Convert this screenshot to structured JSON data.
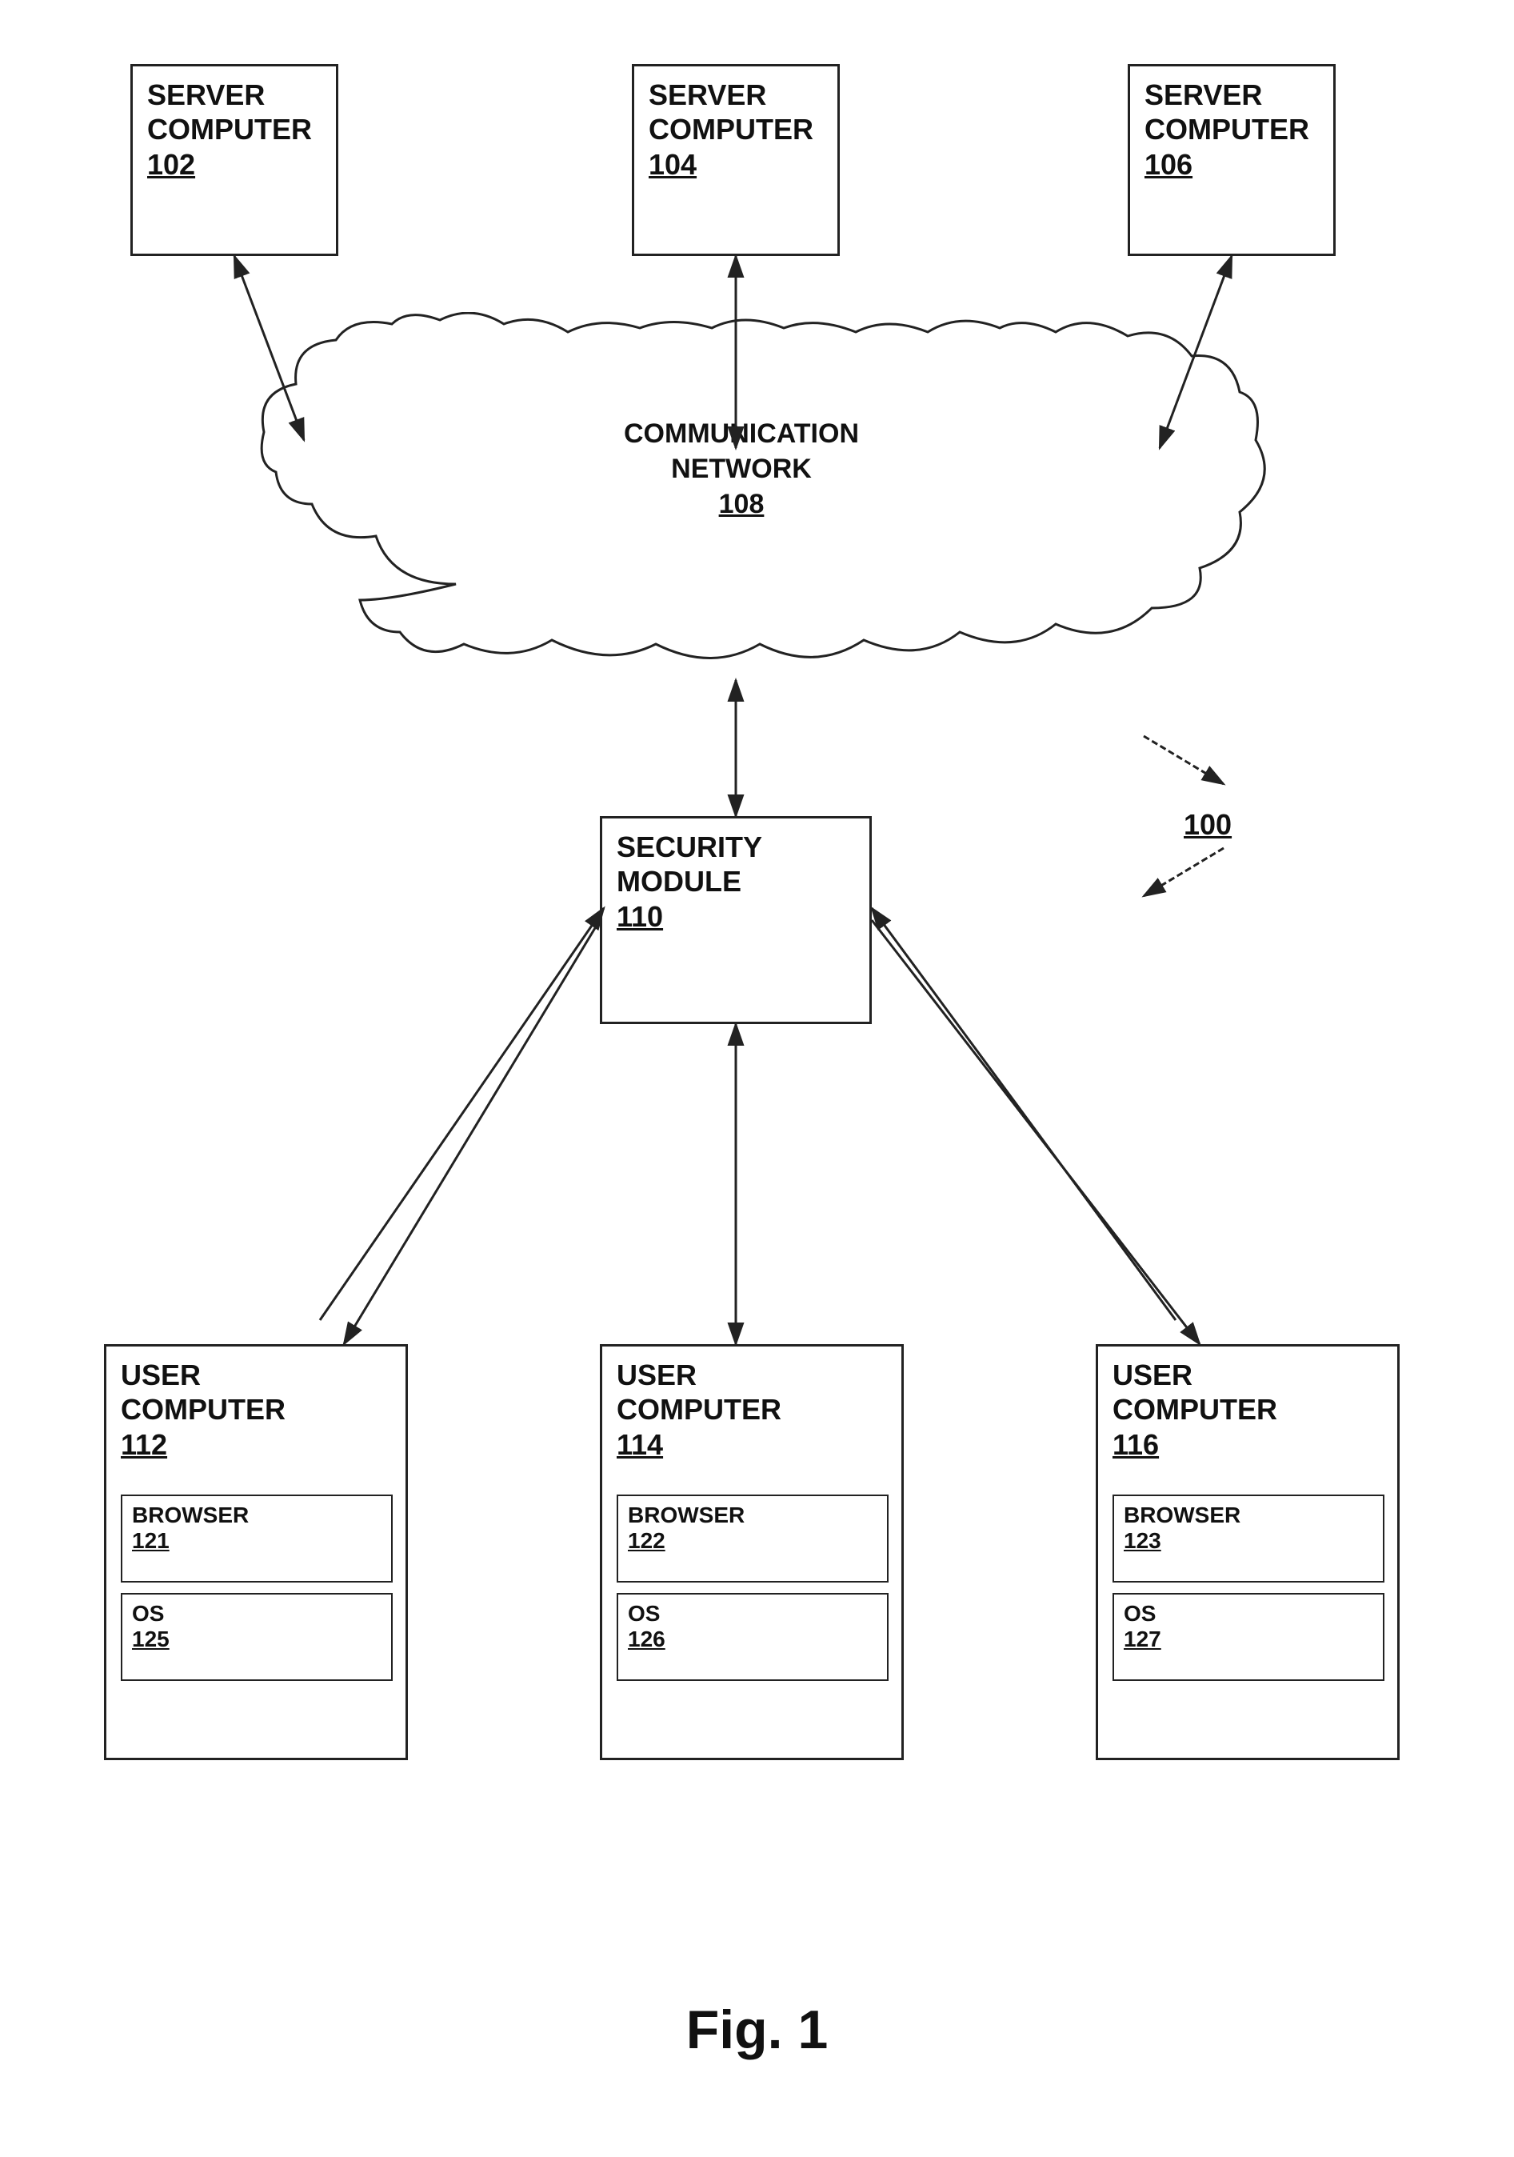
{
  "title": "Fig. 1",
  "servers": [
    {
      "id": "server-102",
      "line1": "SERVER",
      "line2": "COMPUTER",
      "number": "102"
    },
    {
      "id": "server-104",
      "line1": "SERVER",
      "line2": "COMPUTER",
      "number": "104"
    },
    {
      "id": "server-106",
      "line1": "SERVER",
      "line2": "COMPUTER",
      "number": "106"
    }
  ],
  "network": {
    "line1": "COMMUNICATION",
    "line2": "NETWORK",
    "number": "108"
  },
  "security": {
    "line1": "SECURITY",
    "line2": "MODULE",
    "number": "110"
  },
  "ref_number": "100",
  "users": [
    {
      "id": "user-112",
      "line1": "USER",
      "line2": "COMPUTER",
      "number": "112",
      "browser_label": "BROWSER",
      "browser_number": "121",
      "os_label": "OS",
      "os_number": "125"
    },
    {
      "id": "user-114",
      "line1": "USER",
      "line2": "COMPUTER",
      "number": "114",
      "browser_label": "BROWSER",
      "browser_number": "122",
      "os_label": "OS",
      "os_number": "126"
    },
    {
      "id": "user-116",
      "line1": "USER",
      "line2": "COMPUTER",
      "number": "116",
      "browser_label": "BROWSER",
      "browser_number": "123",
      "os_label": "OS",
      "os_number": "127"
    }
  ],
  "fig_label": "Fig. 1"
}
